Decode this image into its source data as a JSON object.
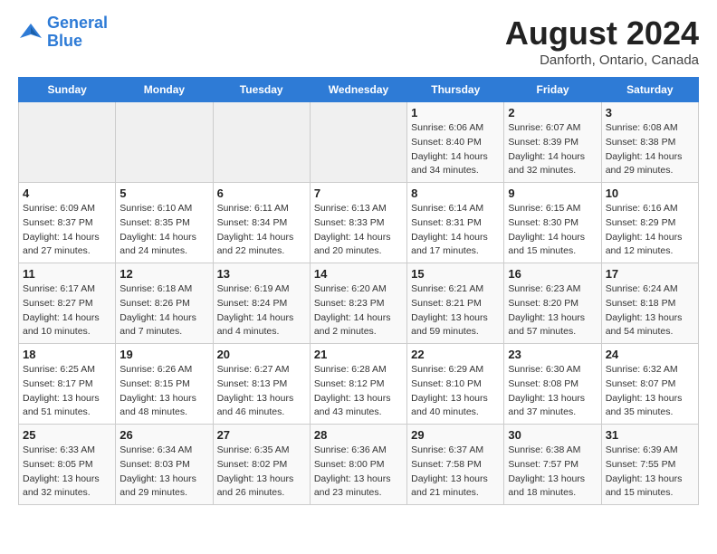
{
  "header": {
    "logo_line1": "General",
    "logo_line2": "Blue",
    "month": "August 2024",
    "location": "Danforth, Ontario, Canada"
  },
  "weekdays": [
    "Sunday",
    "Monday",
    "Tuesday",
    "Wednesday",
    "Thursday",
    "Friday",
    "Saturday"
  ],
  "weeks": [
    [
      {
        "day": "",
        "info": ""
      },
      {
        "day": "",
        "info": ""
      },
      {
        "day": "",
        "info": ""
      },
      {
        "day": "",
        "info": ""
      },
      {
        "day": "1",
        "info": "Sunrise: 6:06 AM\nSunset: 8:40 PM\nDaylight: 14 hours\nand 34 minutes."
      },
      {
        "day": "2",
        "info": "Sunrise: 6:07 AM\nSunset: 8:39 PM\nDaylight: 14 hours\nand 32 minutes."
      },
      {
        "day": "3",
        "info": "Sunrise: 6:08 AM\nSunset: 8:38 PM\nDaylight: 14 hours\nand 29 minutes."
      }
    ],
    [
      {
        "day": "4",
        "info": "Sunrise: 6:09 AM\nSunset: 8:37 PM\nDaylight: 14 hours\nand 27 minutes."
      },
      {
        "day": "5",
        "info": "Sunrise: 6:10 AM\nSunset: 8:35 PM\nDaylight: 14 hours\nand 24 minutes."
      },
      {
        "day": "6",
        "info": "Sunrise: 6:11 AM\nSunset: 8:34 PM\nDaylight: 14 hours\nand 22 minutes."
      },
      {
        "day": "7",
        "info": "Sunrise: 6:13 AM\nSunset: 8:33 PM\nDaylight: 14 hours\nand 20 minutes."
      },
      {
        "day": "8",
        "info": "Sunrise: 6:14 AM\nSunset: 8:31 PM\nDaylight: 14 hours\nand 17 minutes."
      },
      {
        "day": "9",
        "info": "Sunrise: 6:15 AM\nSunset: 8:30 PM\nDaylight: 14 hours\nand 15 minutes."
      },
      {
        "day": "10",
        "info": "Sunrise: 6:16 AM\nSunset: 8:29 PM\nDaylight: 14 hours\nand 12 minutes."
      }
    ],
    [
      {
        "day": "11",
        "info": "Sunrise: 6:17 AM\nSunset: 8:27 PM\nDaylight: 14 hours\nand 10 minutes."
      },
      {
        "day": "12",
        "info": "Sunrise: 6:18 AM\nSunset: 8:26 PM\nDaylight: 14 hours\nand 7 minutes."
      },
      {
        "day": "13",
        "info": "Sunrise: 6:19 AM\nSunset: 8:24 PM\nDaylight: 14 hours\nand 4 minutes."
      },
      {
        "day": "14",
        "info": "Sunrise: 6:20 AM\nSunset: 8:23 PM\nDaylight: 14 hours\nand 2 minutes."
      },
      {
        "day": "15",
        "info": "Sunrise: 6:21 AM\nSunset: 8:21 PM\nDaylight: 13 hours\nand 59 minutes."
      },
      {
        "day": "16",
        "info": "Sunrise: 6:23 AM\nSunset: 8:20 PM\nDaylight: 13 hours\nand 57 minutes."
      },
      {
        "day": "17",
        "info": "Sunrise: 6:24 AM\nSunset: 8:18 PM\nDaylight: 13 hours\nand 54 minutes."
      }
    ],
    [
      {
        "day": "18",
        "info": "Sunrise: 6:25 AM\nSunset: 8:17 PM\nDaylight: 13 hours\nand 51 minutes."
      },
      {
        "day": "19",
        "info": "Sunrise: 6:26 AM\nSunset: 8:15 PM\nDaylight: 13 hours\nand 48 minutes."
      },
      {
        "day": "20",
        "info": "Sunrise: 6:27 AM\nSunset: 8:13 PM\nDaylight: 13 hours\nand 46 minutes."
      },
      {
        "day": "21",
        "info": "Sunrise: 6:28 AM\nSunset: 8:12 PM\nDaylight: 13 hours\nand 43 minutes."
      },
      {
        "day": "22",
        "info": "Sunrise: 6:29 AM\nSunset: 8:10 PM\nDaylight: 13 hours\nand 40 minutes."
      },
      {
        "day": "23",
        "info": "Sunrise: 6:30 AM\nSunset: 8:08 PM\nDaylight: 13 hours\nand 37 minutes."
      },
      {
        "day": "24",
        "info": "Sunrise: 6:32 AM\nSunset: 8:07 PM\nDaylight: 13 hours\nand 35 minutes."
      }
    ],
    [
      {
        "day": "25",
        "info": "Sunrise: 6:33 AM\nSunset: 8:05 PM\nDaylight: 13 hours\nand 32 minutes."
      },
      {
        "day": "26",
        "info": "Sunrise: 6:34 AM\nSunset: 8:03 PM\nDaylight: 13 hours\nand 29 minutes."
      },
      {
        "day": "27",
        "info": "Sunrise: 6:35 AM\nSunset: 8:02 PM\nDaylight: 13 hours\nand 26 minutes."
      },
      {
        "day": "28",
        "info": "Sunrise: 6:36 AM\nSunset: 8:00 PM\nDaylight: 13 hours\nand 23 minutes."
      },
      {
        "day": "29",
        "info": "Sunrise: 6:37 AM\nSunset: 7:58 PM\nDaylight: 13 hours\nand 21 minutes."
      },
      {
        "day": "30",
        "info": "Sunrise: 6:38 AM\nSunset: 7:57 PM\nDaylight: 13 hours\nand 18 minutes."
      },
      {
        "day": "31",
        "info": "Sunrise: 6:39 AM\nSunset: 7:55 PM\nDaylight: 13 hours\nand 15 minutes."
      }
    ]
  ]
}
